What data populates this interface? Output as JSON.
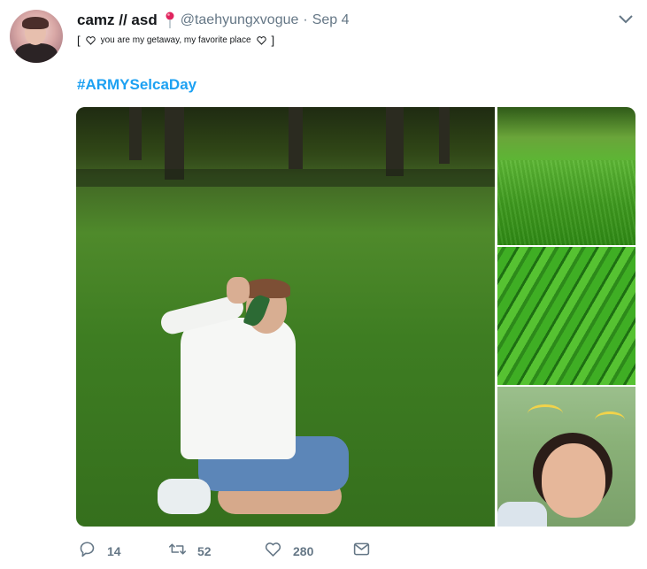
{
  "tweet": {
    "display_name": "camz // asd",
    "name_emoji": "pin-emoji",
    "handle": "@taehyungxvogue",
    "separator": "·",
    "date": "Sep 4",
    "bio_open": "[",
    "bio_text": "you are my getaway, my favorite place",
    "bio_close": "]",
    "hashtag": "#ARMYSelcaDay"
  },
  "actions": {
    "reply_count": "14",
    "retweet_count": "52",
    "like_count": "280"
  },
  "colors": {
    "link": "#1da1f2",
    "muted": "#657786",
    "text": "#14171a"
  },
  "icons": [
    "chevron-down-icon",
    "heart-outline-icon",
    "reply-icon",
    "retweet-icon",
    "like-icon",
    "dm-icon"
  ]
}
